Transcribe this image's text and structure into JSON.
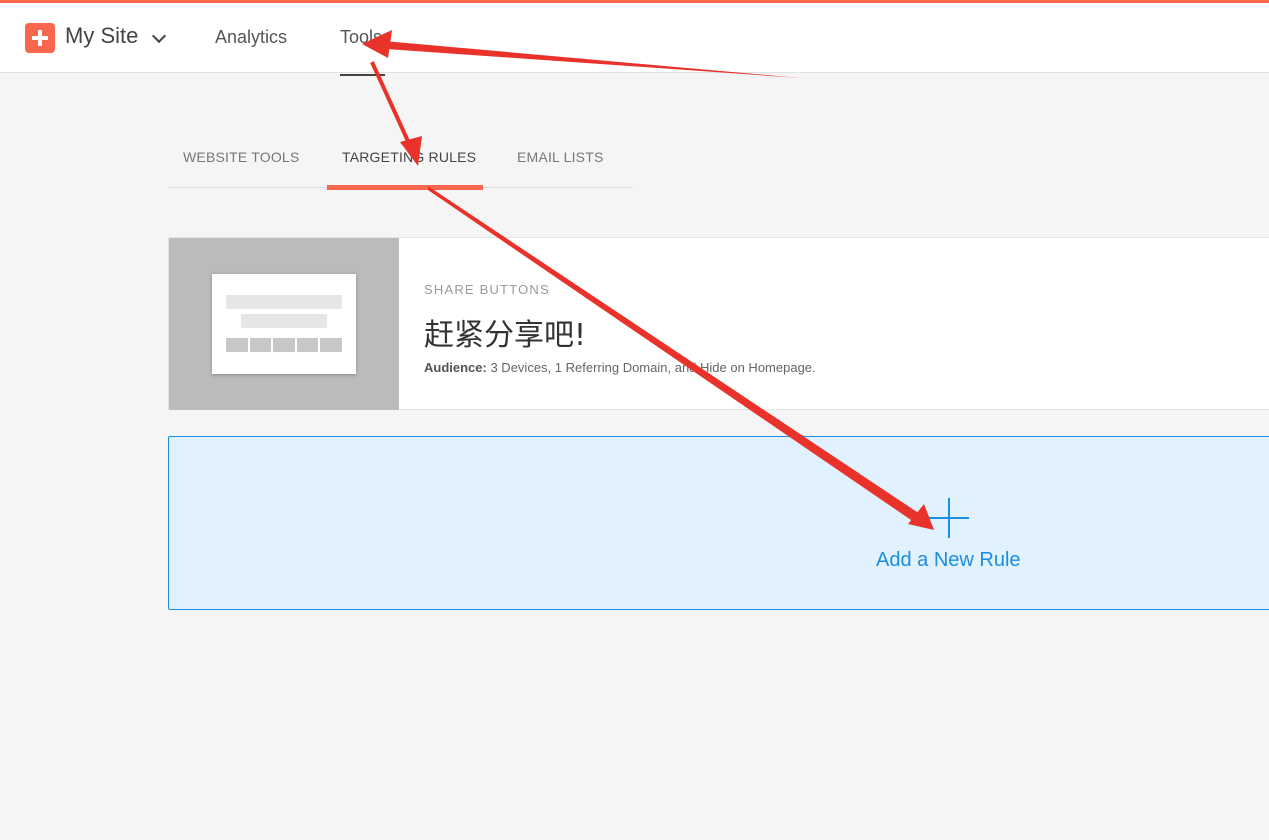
{
  "header": {
    "site_name": "My Site",
    "nav": {
      "analytics": "Analytics",
      "tools": "Tools"
    },
    "brand_color": "#f7664d"
  },
  "tabs": {
    "website_tools": "WEBSITE TOOLS",
    "targeting_rules": "TARGETING RULES",
    "email_lists": "EMAIL LISTS",
    "active": "TARGETING RULES"
  },
  "rule": {
    "kicker": "SHARE BUTTONS",
    "title": "赶紧分享吧!",
    "audience_label": "Audience:",
    "audience_value": "3 Devices, 1 Referring Domain, and Hide on Homepage."
  },
  "add_rule": {
    "label": "Add a New Rule",
    "accent_color": "#1a8fe0"
  },
  "annotations": {
    "arrow_color": "#e8322a"
  }
}
